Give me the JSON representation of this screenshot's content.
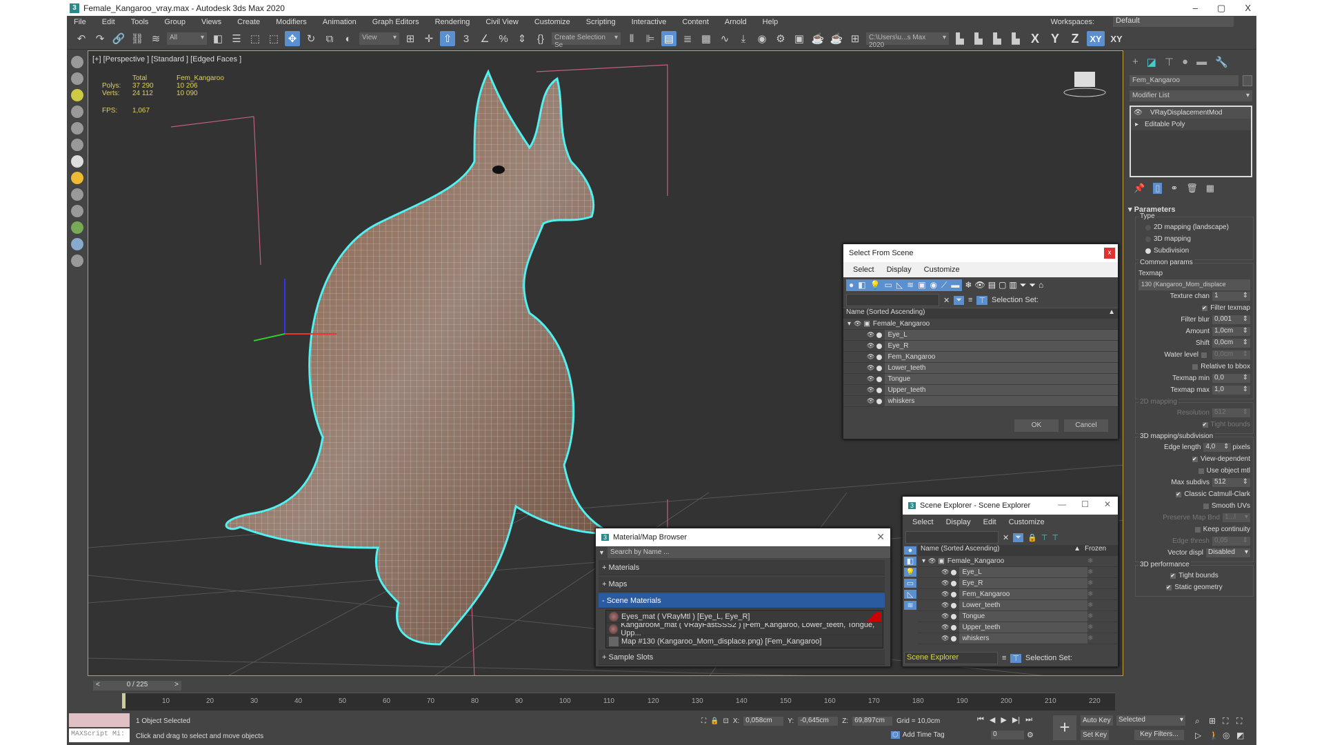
{
  "window": {
    "title": "Female_Kangaroo_vray.max - Autodesk 3ds Max 2020",
    "min": "–",
    "max": "▢",
    "close": "X"
  },
  "menu": [
    "File",
    "Edit",
    "Tools",
    "Group",
    "Views",
    "Create",
    "Modifiers",
    "Animation",
    "Graph Editors",
    "Rendering",
    "Civil View",
    "Customize",
    "Scripting",
    "Interactive",
    "Content",
    "Arnold",
    "Help"
  ],
  "workspace": {
    "label": "Workspaces:",
    "value": "Default"
  },
  "toolbar": {
    "filter": "All",
    "ref_coord": "View",
    "selection_set": "Create Selection Se",
    "project_path": "C:\\Users\\u...s Max 2020",
    "axes": [
      "X",
      "Y",
      "Z",
      "XY",
      "XY"
    ]
  },
  "viewport": {
    "label": "[+] [Perspective ] [Standard ] [Edged Faces ]",
    "stats": {
      "total_label": "Total",
      "object_label": "Fem_Kangaroo",
      "polys_label": "Polys:",
      "polys_total": "37 290",
      "polys_obj": "10 206",
      "verts_label": "Verts:",
      "verts_total": "24 112",
      "verts_obj": "10 090",
      "fps_label": "FPS:",
      "fps": "1,067"
    }
  },
  "command_panel": {
    "object_name": "Fem_Kangaroo",
    "modifier_list": "Modifier List",
    "stack": [
      "VRayDisplacementMod",
      "Editable Poly"
    ],
    "params_title": "Parameters",
    "type_label": "Type",
    "type_options": [
      "2D mapping (landscape)",
      "3D mapping",
      "Subdivision"
    ],
    "type_selected": "Subdivision",
    "common_params": "Common params",
    "texmap_label": "Texmap",
    "texmap_value": "130 (Kangaroo_Mom_displace",
    "texture_chan_label": "Texture chan",
    "texture_chan": "1",
    "filter_texmap": "Filter texmap",
    "filter_blur_label": "Filter blur",
    "filter_blur": "0,001",
    "amount_label": "Amount",
    "amount": "1,0cm",
    "shift_label": "Shift",
    "shift": "0,0cm",
    "water_label": "Water level",
    "water": "0,0cm",
    "relative_bbox": "Relative to bbox",
    "texmap_min_label": "Texmap min",
    "texmap_min": "0,0",
    "texmap_max_label": "Texmap max",
    "texmap_max": "1,0",
    "map2d_title": "2D mapping",
    "resolution_label": "Resolution",
    "resolution": "512",
    "tight_bounds_2d": "Tight bounds",
    "map3d_title": "3D mapping/subdivision",
    "edge_length_label": "Edge length",
    "edge_length": "4,0",
    "pixels": "pixels",
    "view_dependent": "View-dependent",
    "use_object_mtl": "Use object mtl",
    "max_subdivs_label": "Max subdivs",
    "max_subdivs": "512",
    "catmull": "Classic Catmull-Clark",
    "smooth_uvs": "Smooth UVs",
    "preserve_label": "Preserve Map Bnd",
    "preserve": "1...l",
    "keep_continuity": "Keep continuity",
    "edge_thresh_label": "Edge thresh",
    "edge_thresh": "0,05",
    "vector_label": "Vector displ",
    "vector": "Disabled",
    "perf_title": "3D performance",
    "tight_bounds": "Tight bounds",
    "static_geometry": "Static geometry"
  },
  "select_from_scene": {
    "title": "Select From Scene",
    "close": "x",
    "menu": [
      "Select",
      "Display",
      "Customize"
    ],
    "selection_set": "Selection Set:",
    "column": "Name (Sorted Ascending)",
    "root": "Female_Kangaroo",
    "items": [
      "Eye_L",
      "Eye_R",
      "Fem_Kangaroo",
      "Lower_teeth",
      "Tongue",
      "Upper_teeth",
      "whiskers"
    ],
    "ok": "OK",
    "cancel": "Cancel"
  },
  "material_browser": {
    "title": "Material/Map Browser",
    "search_placeholder": "Search by Name ...",
    "sections": [
      "+ Materials",
      "+ Maps",
      "-  Scene Materials",
      "+ Sample Slots"
    ],
    "items": [
      "Eyes_mat  ( VRayMtl )  [Eye_L, Eye_R]",
      "KangarooM_mat  ( VRayFastSSS2 )  [Fem_Kangaroo, Lower_teeth, Tongue, Upp...",
      "Map #130 (Kangaroo_Mom_displace.png) [Fem_Kangaroo]"
    ]
  },
  "scene_explorer": {
    "title": "Scene Explorer - Scene Explorer",
    "menu": [
      "Select",
      "Display",
      "Edit",
      "Customize"
    ],
    "column": "Name (Sorted Ascending)",
    "frozen": "Frozen",
    "root": "Female_Kangaroo",
    "items": [
      "Eye_L",
      "Eye_R",
      "Fem_Kangaroo",
      "Lower_teeth",
      "Tongue",
      "Upper_teeth",
      "whiskers"
    ],
    "explorer_name": "Scene Explorer",
    "selection_set": "Selection Set:"
  },
  "timeline": {
    "frame": "0 / 225",
    "prev": "<",
    "next": ">",
    "ticks": [
      "10",
      "20",
      "30",
      "40",
      "50",
      "60",
      "70",
      "80",
      "90",
      "100",
      "110",
      "120",
      "130",
      "140",
      "150",
      "160",
      "170",
      "180",
      "190",
      "200",
      "210",
      "220"
    ],
    "progress": 0
  },
  "status": {
    "maxscript": "MAXScript Mi:",
    "selected": "1 Object Selected",
    "prompt": "Click and drag to select and move objects",
    "x_label": "X:",
    "x": "0,058cm",
    "y_label": "Y:",
    "y": "-0,645cm",
    "z_label": "Z:",
    "z": "69,897cm",
    "grid": "Grid = 10,0cm",
    "add_time_tag": "Add Time Tag",
    "current_frame": "0",
    "auto_key": "Auto Key",
    "set_key": "Set Key",
    "key_mode": "Selected",
    "key_filters": "Key Filters..."
  }
}
